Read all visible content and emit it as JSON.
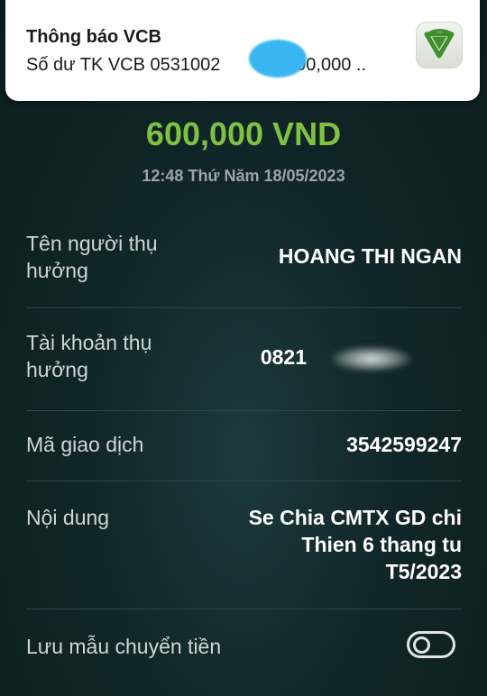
{
  "notification": {
    "title": "Thông báo VCB",
    "body": "Số dư TK VCB 0531002",
    "body_suffix": "-600,000 ..",
    "icon": "vcb-logo-icon"
  },
  "transaction": {
    "amount": "600,000 VND",
    "datetime": "12:48 Thứ Năm 18/05/2023"
  },
  "details": [
    {
      "label": "Tên người thụ hưởng",
      "value": "HOANG THI NGAN"
    },
    {
      "label": "Tài khoản thụ hưởng",
      "value": "0821"
    },
    {
      "label": "Mã giao dịch",
      "value": "3542599247"
    },
    {
      "label": "Nội dung",
      "value": "Se Chia CMTX GD chi Thien 6 thang tu T5/2023"
    }
  ],
  "save_template": {
    "label": "Lưu mẫu chuyển tiền",
    "enabled": false
  },
  "colors": {
    "amount": "#7fc241",
    "background": "#112628",
    "vcb_green": "#3f8f2c"
  }
}
